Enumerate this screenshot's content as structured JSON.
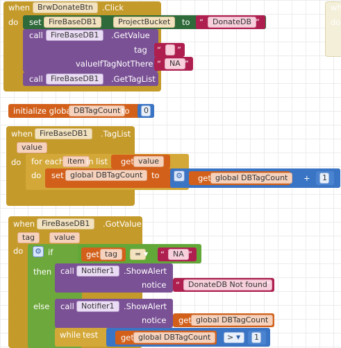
{
  "block1": {
    "when": "when",
    "component": "BrwDonateBtn",
    "event": ".Click",
    "do": "do",
    "set": "set",
    "set_comp": "FireBaseDB1",
    "set_prop": "ProjectBucket",
    "to": "to",
    "set_value": "DonateDB",
    "call": "call",
    "getvalue_comp": "FireBaseDB1",
    "getvalue": ".GetValue",
    "tag_label": "tag",
    "tag_value": "",
    "vitnt_label": "valueIfTagNotThere",
    "vitnt_value": "NA",
    "gettaglist_comp": "FireBaseDB1",
    "gettaglist": ".GetTagList"
  },
  "init": {
    "label": "initialize global",
    "var": "DBTagCount",
    "to": "to",
    "value": "0"
  },
  "block2": {
    "when": "when",
    "component": "FireBaseDB1",
    "event": ".TagList",
    "param": "value",
    "do": "do",
    "foreach": "for each",
    "item": "item",
    "inlist": "in list",
    "get": "get",
    "get_var": "value",
    "do2": "do",
    "set": "set",
    "set_var": "global DBTagCount",
    "to": "to",
    "gear": "⚙",
    "get2": "get",
    "get2_var": "global DBTagCount",
    "plus": "+",
    "num": "1"
  },
  "block3": {
    "when": "when",
    "component": "FireBaseDB1",
    "event": ".GotValue",
    "param1": "tag",
    "param2": "value",
    "do": "do",
    "gear": "⚙",
    "if": "if",
    "get": "get",
    "get_var": "tag",
    "eq": "=",
    "na": "NA",
    "then": "then",
    "call": "call",
    "notifier": "Notifier1",
    "showalert": ".ShowAlert",
    "notice": "notice",
    "notice_value": "DonateDB Not found",
    "else": "else",
    "call2": "call",
    "notifier2": "Notifier1",
    "showalert2": ".ShowAlert",
    "notice2": "notice",
    "get2": "get",
    "get2_var": "global DBTagCount",
    "while": "while",
    "test": "test",
    "get3": "get",
    "get3_var": "global DBTagCount",
    "gt": ">",
    "num": "1"
  },
  "side": {
    "when": "wh",
    "do": "do"
  },
  "colors": {
    "event": "#c49a2b",
    "component": "#7a5195",
    "setter": "#3d8a3d",
    "variable": "#d2601a",
    "text": "#ae1e4f",
    "math": "#3a74c4",
    "logic": "#62a838"
  }
}
